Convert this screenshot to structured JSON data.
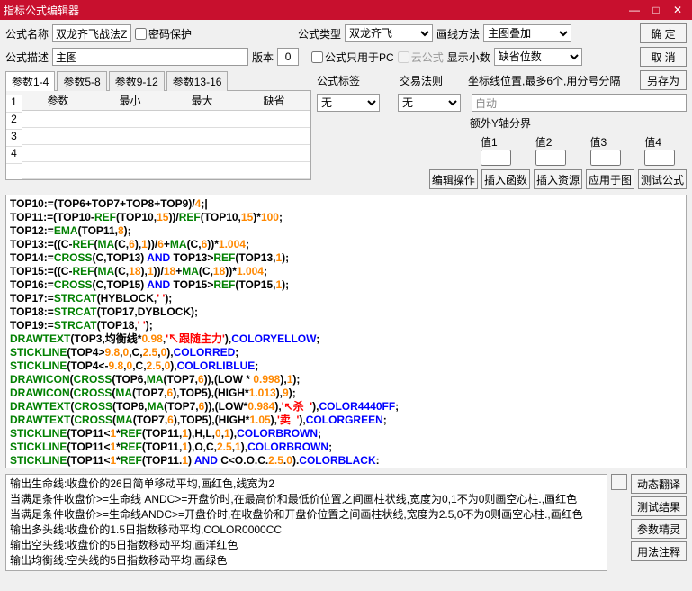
{
  "title": "指标公式编辑器",
  "labels": {
    "gsmc": "公式名称",
    "mmbh": "密码保护",
    "gslx": "公式类型",
    "hxff": "画线方法",
    "gsms": "公式描述",
    "ver": "版本",
    "pconly": "公式只用于PC",
    "cloud": "云公式",
    "xsxs": "显示小数",
    "ok": "确 定",
    "cancel": "取 消",
    "saveas": "另存为",
    "gsbq": "公式标签",
    "jyfz": "交易法则",
    "coord": "坐标线位置,最多6个,用分号分隔",
    "yaxis": "额外Y轴分界",
    "v1": "值1",
    "v2": "值2",
    "v3": "值3",
    "v4": "值4",
    "editop": "编辑操作",
    "insfn": "插入函数",
    "insres": "插入资源",
    "apply": "应用于图",
    "test": "测试公式",
    "auto": "自动",
    "none": "无",
    "dtfy": "动态翻译",
    "csjg": "测试结果",
    "csjl": "参数精灵",
    "yfzs": "用法注释"
  },
  "values": {
    "name": "双龙齐飞战法Z",
    "desc": "主图",
    "ver": "0",
    "type": "双龙齐飞",
    "draw": "主图叠加",
    "decimal": "缺省位数"
  },
  "paramTabs": [
    "参数1-4",
    "参数5-8",
    "参数9-12",
    "参数13-16"
  ],
  "paramHeaders": [
    "",
    "参数",
    "最小",
    "最大",
    "缺省"
  ],
  "paramRows": [
    "1",
    "2",
    "3",
    "4"
  ],
  "output": [
    "输出生命线:收盘价的26日简单移动平均,画红色,线宽为2",
    "当满足条件收盘价>=生命线 ANDC>=开盘价时,在最高价和最低价位置之间画柱状线,宽度为0,1不为0则画空心柱.,画红色",
    "当满足条件收盘价>=生命线ANDC>=开盘价时,在收盘价和开盘价位置之间画柱状线,宽度为2.5,0不为0则画空心柱.,画红色",
    "输出多头线:收盘价的1.5日指数移动平均,COLOR0000CC",
    "输出空头线:收盘价的5日指数移动平均,画洋红色",
    "输出均衡线:空头线的5日指数移动平均,画绿色"
  ],
  "chart_data": null
}
